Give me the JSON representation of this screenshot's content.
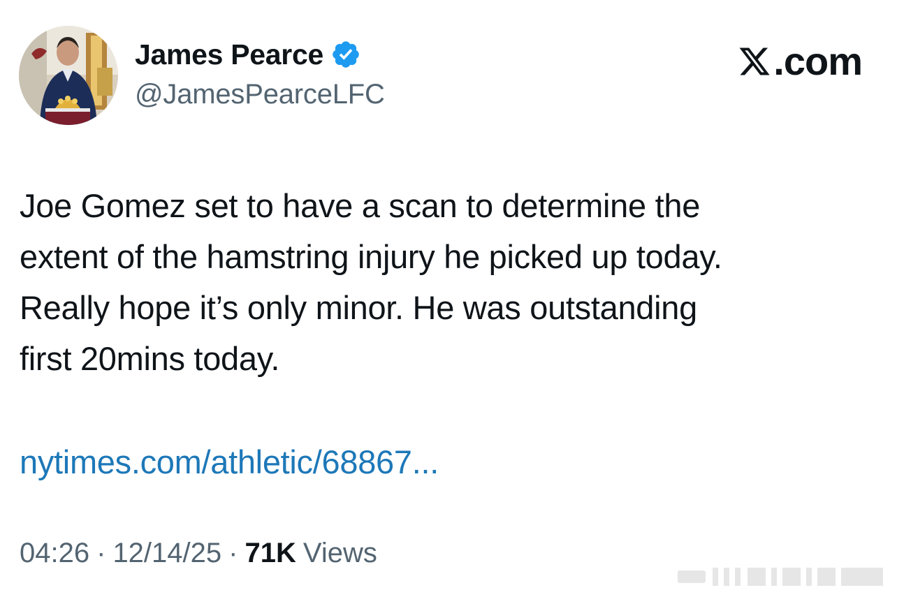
{
  "author": {
    "display_name": "James Pearce",
    "handle": "@JamesPearceLFC",
    "verified": true,
    "avatar": "avatar-photo"
  },
  "brand": {
    "logo": "x-logo-icon",
    "text": ".com"
  },
  "tweet": {
    "lines": [
      "Joe Gomez set to have a scan to determine the",
      "extent of the hamstring injury he picked up today.",
      "Really hope it’s only minor. He was outstanding",
      "first 20mins today."
    ],
    "link": "nytimes.com/athletic/68867..."
  },
  "meta": {
    "time": "04:26",
    "date": "12/14/25",
    "separator": "·",
    "views_count": "71K",
    "views_label": "Views"
  },
  "colors": {
    "text": "#0f1419",
    "secondary": "#536471",
    "link": "#1d78b8",
    "verified": "#1d9bf0"
  }
}
